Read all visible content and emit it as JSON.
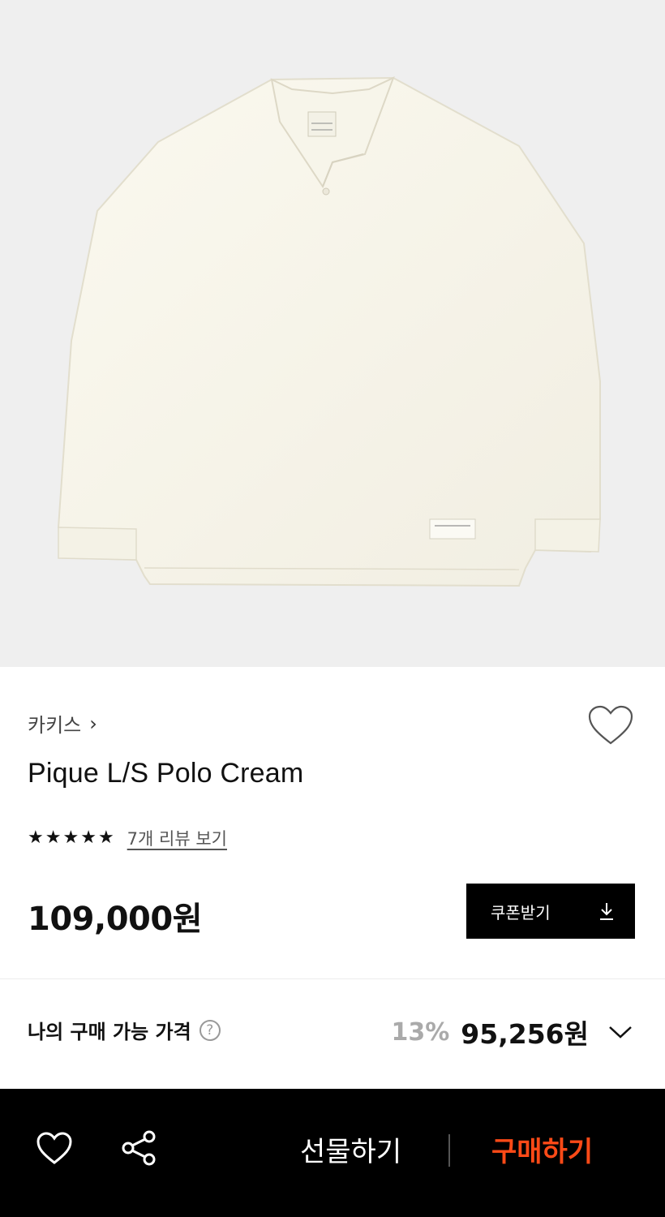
{
  "product": {
    "image_alt": "Cream long-sleeve pique polo shirt",
    "brand": "카키스",
    "brand_chevron": "›",
    "title": "Pique L/S Polo Cream",
    "rating_stars": 5,
    "review_link": "7개 리뷰 보기",
    "price": "109,000원"
  },
  "coupon": {
    "label": "쿠폰받기",
    "icon": "download-icon"
  },
  "my_price": {
    "label": "나의 구매 가능 가격",
    "help": "?",
    "discount": "13%",
    "amount": "95,256원"
  },
  "bottom_bar": {
    "gift_label": "선물하기",
    "buy_label": "구매하기",
    "buy_color": "#ff4a17"
  }
}
